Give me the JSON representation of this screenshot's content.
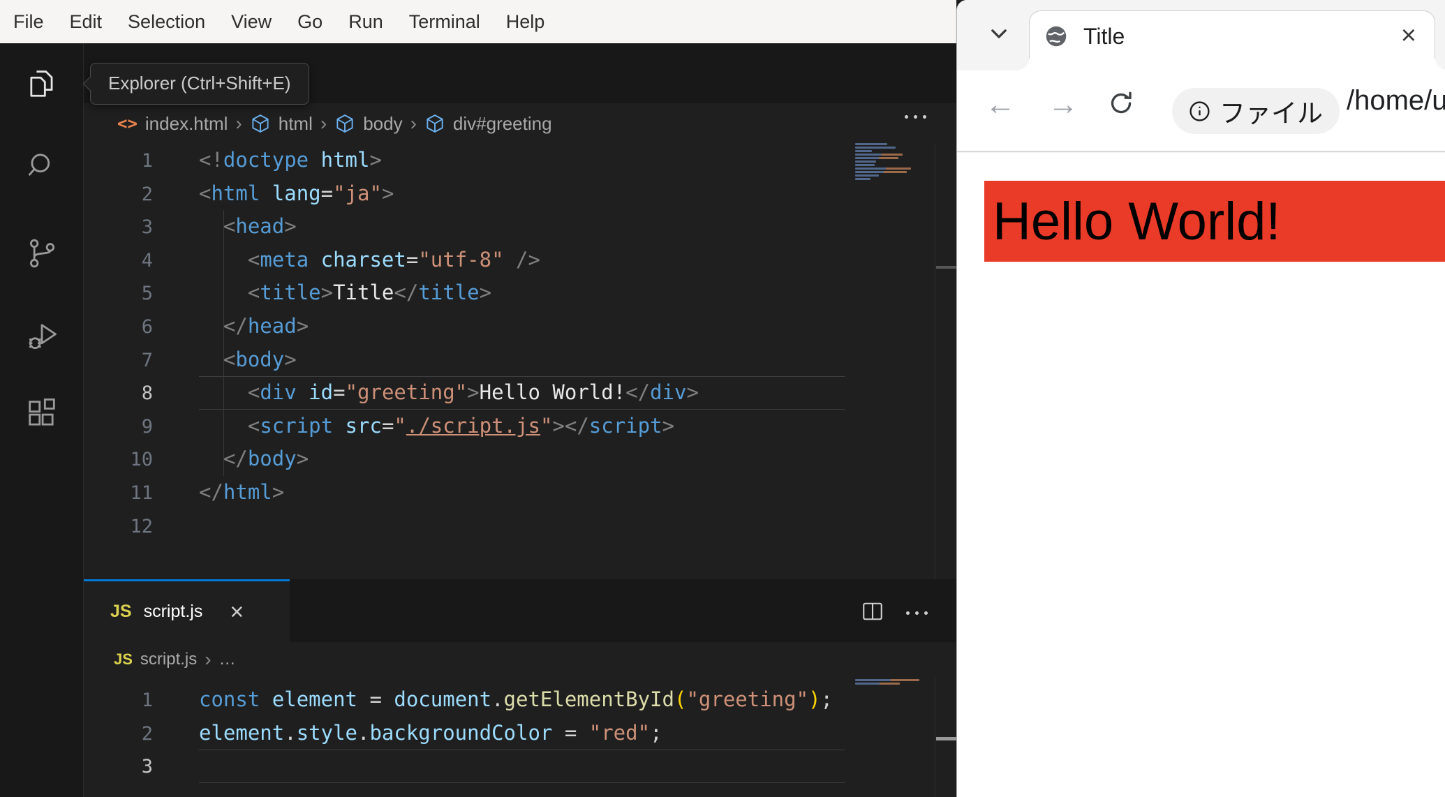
{
  "vscode": {
    "menu_items": [
      "File",
      "Edit",
      "Selection",
      "View",
      "Go",
      "Run",
      "Terminal",
      "Help"
    ],
    "tooltip_text": "Explorer (Ctrl+Shift+E)",
    "breadcrumbs_html": {
      "file_icon": "<>",
      "file": "index.html",
      "sep": "›",
      "path": [
        "html",
        "body",
        "div#greeting"
      ]
    },
    "html_editor": {
      "active_line": 8,
      "lines": [
        {
          "tokens": [
            {
              "c": "p",
              "t": "<!"
            },
            {
              "c": "tag",
              "t": "doctype"
            },
            {
              "c": "pl",
              "t": " "
            },
            {
              "c": "attr",
              "t": "html"
            },
            {
              "c": "p",
              "t": ">"
            }
          ]
        },
        {
          "tokens": [
            {
              "c": "p",
              "t": "<"
            },
            {
              "c": "tag",
              "t": "html"
            },
            {
              "c": "pl",
              "t": " "
            },
            {
              "c": "attr",
              "t": "lang"
            },
            {
              "c": "op",
              "t": "="
            },
            {
              "c": "str",
              "t": "\"ja\""
            },
            {
              "c": "p",
              "t": ">"
            }
          ]
        },
        {
          "tokens": [
            {
              "c": "pl",
              "t": "  "
            },
            {
              "c": "p",
              "t": "<"
            },
            {
              "c": "tag",
              "t": "head"
            },
            {
              "c": "p",
              "t": ">"
            }
          ]
        },
        {
          "tokens": [
            {
              "c": "pl",
              "t": "    "
            },
            {
              "c": "p",
              "t": "<"
            },
            {
              "c": "tag",
              "t": "meta"
            },
            {
              "c": "pl",
              "t": " "
            },
            {
              "c": "attr",
              "t": "charset"
            },
            {
              "c": "op",
              "t": "="
            },
            {
              "c": "str",
              "t": "\"utf-8\""
            },
            {
              "c": "pl",
              "t": " "
            },
            {
              "c": "p",
              "t": "/>"
            }
          ]
        },
        {
          "tokens": [
            {
              "c": "pl",
              "t": "    "
            },
            {
              "c": "p",
              "t": "<"
            },
            {
              "c": "tag",
              "t": "title"
            },
            {
              "c": "p",
              "t": ">"
            },
            {
              "c": "txt",
              "t": "Title"
            },
            {
              "c": "p",
              "t": "</"
            },
            {
              "c": "tag",
              "t": "title"
            },
            {
              "c": "p",
              "t": ">"
            }
          ]
        },
        {
          "tokens": [
            {
              "c": "pl",
              "t": "  "
            },
            {
              "c": "p",
              "t": "</"
            },
            {
              "c": "tag",
              "t": "head"
            },
            {
              "c": "p",
              "t": ">"
            }
          ]
        },
        {
          "tokens": [
            {
              "c": "pl",
              "t": "  "
            },
            {
              "c": "p",
              "t": "<"
            },
            {
              "c": "tag",
              "t": "body"
            },
            {
              "c": "p",
              "t": ">"
            }
          ]
        },
        {
          "tokens": [
            {
              "c": "pl",
              "t": "    "
            },
            {
              "c": "p",
              "t": "<"
            },
            {
              "c": "tag",
              "t": "div"
            },
            {
              "c": "pl",
              "t": " "
            },
            {
              "c": "attr",
              "t": "id"
            },
            {
              "c": "op",
              "t": "="
            },
            {
              "c": "str",
              "t": "\"greeting\""
            },
            {
              "c": "p",
              "t": ">"
            },
            {
              "c": "txt",
              "t": "Hello World!"
            },
            {
              "c": "p",
              "t": "</"
            },
            {
              "c": "tag",
              "t": "div"
            },
            {
              "c": "p",
              "t": ">"
            }
          ]
        },
        {
          "tokens": [
            {
              "c": "pl",
              "t": "    "
            },
            {
              "c": "p",
              "t": "<"
            },
            {
              "c": "tag",
              "t": "script"
            },
            {
              "c": "pl",
              "t": " "
            },
            {
              "c": "attr",
              "t": "src"
            },
            {
              "c": "op",
              "t": "="
            },
            {
              "c": "str",
              "t": "\""
            },
            {
              "c": "link",
              "t": "./script.js"
            },
            {
              "c": "str",
              "t": "\""
            },
            {
              "c": "p",
              "t": ">"
            },
            {
              "c": "p",
              "t": "</"
            },
            {
              "c": "tag",
              "t": "script"
            },
            {
              "c": "p",
              "t": ">"
            }
          ]
        },
        {
          "tokens": [
            {
              "c": "pl",
              "t": "  "
            },
            {
              "c": "p",
              "t": "</"
            },
            {
              "c": "tag",
              "t": "body"
            },
            {
              "c": "p",
              "t": ">"
            }
          ]
        },
        {
          "tokens": [
            {
              "c": "p",
              "t": "</"
            },
            {
              "c": "tag",
              "t": "html"
            },
            {
              "c": "p",
              "t": ">"
            }
          ]
        },
        {
          "tokens": []
        }
      ]
    },
    "panel": {
      "js_icon": "JS",
      "tab_label": "script.js",
      "close_glyph": "×"
    },
    "breadcrumbs_js": {
      "js_icon": "JS",
      "file": "script.js",
      "sep": "›",
      "ellipsis": "…"
    },
    "js_editor": {
      "active_line": 3,
      "lines": [
        {
          "tokens": [
            {
              "c": "kw",
              "t": "const"
            },
            {
              "c": "pl",
              "t": " "
            },
            {
              "c": "attr",
              "t": "element"
            },
            {
              "c": "op",
              "t": " = "
            },
            {
              "c": "attr",
              "t": "document"
            },
            {
              "c": "op",
              "t": "."
            },
            {
              "c": "fn",
              "t": "getElementById"
            },
            {
              "c": "par",
              "t": "("
            },
            {
              "c": "str",
              "t": "\"greeting\""
            },
            {
              "c": "par",
              "t": ")"
            },
            {
              "c": "op",
              "t": ";"
            }
          ]
        },
        {
          "tokens": [
            {
              "c": "attr",
              "t": "element"
            },
            {
              "c": "op",
              "t": "."
            },
            {
              "c": "attr",
              "t": "style"
            },
            {
              "c": "op",
              "t": "."
            },
            {
              "c": "attr",
              "t": "backgroundColor"
            },
            {
              "c": "op",
              "t": " = "
            },
            {
              "c": "str",
              "t": "\"red\""
            },
            {
              "c": "op",
              "t": ";"
            }
          ]
        },
        {
          "tokens": []
        }
      ]
    }
  },
  "browser": {
    "tab": {
      "title": "Title",
      "close_glyph": "×"
    },
    "toolbar": {
      "back_glyph": "←",
      "forward_glyph": "→",
      "chip_label": "ファイル",
      "url": "/home/u"
    },
    "page": {
      "heading": "Hello World!"
    }
  },
  "colors": {
    "accent_blue": "#0078d4",
    "heading_bg": "#ea3a28",
    "js_yellow": "#dcd24f"
  }
}
